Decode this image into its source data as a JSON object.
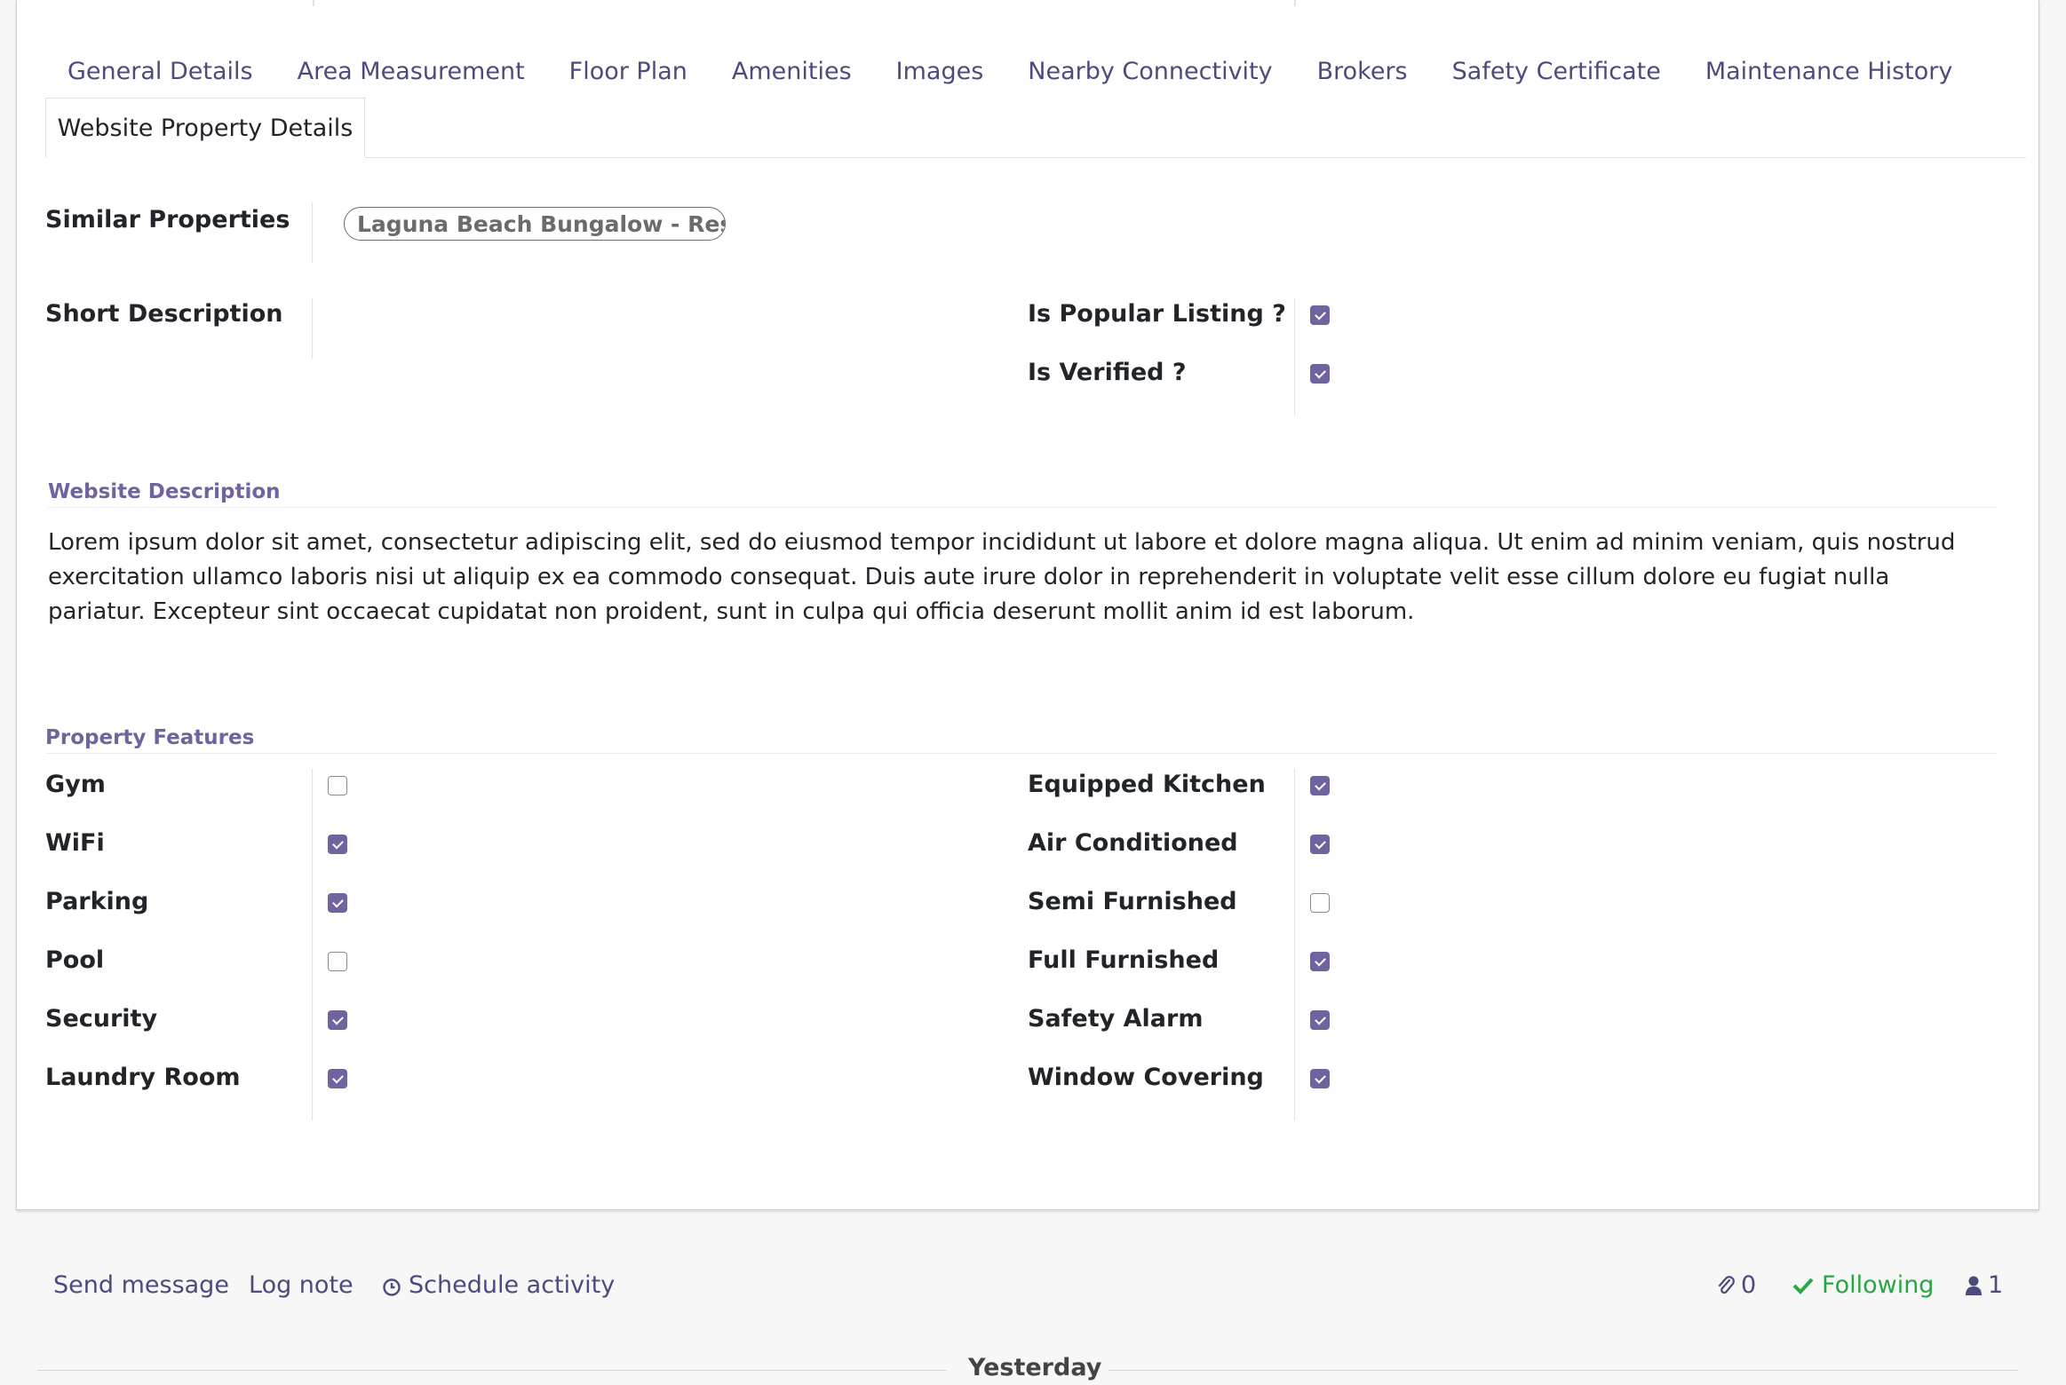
{
  "tabs": [
    "General Details",
    "Area Measurement",
    "Floor Plan",
    "Amenities",
    "Images",
    "Nearby Connectivity",
    "Brokers",
    "Safety Certificate",
    "Maintenance History"
  ],
  "active_tab": "Website Property Details",
  "fields": {
    "similar_properties": {
      "label": "Similar Properties",
      "tag": "Laguna Beach Bungalow - Res..."
    },
    "short_description": {
      "label": "Short Description",
      "value": ""
    },
    "is_popular_listing": {
      "label": "Is Popular Listing ?",
      "checked": true
    },
    "is_verified": {
      "label": "Is Verified ?",
      "checked": true
    }
  },
  "website_description": {
    "title": "Website Description",
    "text": "Lorem ipsum dolor sit amet, consectetur adipiscing elit, sed do eiusmod tempor incididunt ut labore et dolore magna aliqua. Ut enim ad minim veniam, quis nostrud exercitation ullamco laboris nisi ut aliquip ex ea commodo consequat. Duis aute irure dolor in reprehenderit in voluptate velit esse cillum dolore eu fugiat nulla pariatur. Excepteur sint occaecat cupidatat non proident, sunt in culpa qui officia deserunt mollit anim id est laborum."
  },
  "property_features": {
    "title": "Property Features",
    "left": [
      {
        "label": "Gym",
        "checked": false
      },
      {
        "label": "WiFi",
        "checked": true
      },
      {
        "label": "Parking",
        "checked": true
      },
      {
        "label": "Pool",
        "checked": false
      },
      {
        "label": "Security",
        "checked": true
      },
      {
        "label": "Laundry Room",
        "checked": true
      }
    ],
    "right": [
      {
        "label": "Equipped Kitchen",
        "checked": true
      },
      {
        "label": "Air Conditioned",
        "checked": true
      },
      {
        "label": "Semi Furnished",
        "checked": false
      },
      {
        "label": "Full Furnished",
        "checked": true
      },
      {
        "label": "Safety Alarm",
        "checked": true
      },
      {
        "label": "Window Covering",
        "checked": true
      }
    ]
  },
  "chatter": {
    "send_message": "Send message",
    "log_note": "Log note",
    "schedule_activity": "Schedule activity",
    "attachments_count": "0",
    "following": "Following",
    "followers_count": "1",
    "date_separator": "Yesterday"
  },
  "colors": {
    "accent": "#71639e",
    "link": "#4c4b7d",
    "following": "#28a745"
  }
}
